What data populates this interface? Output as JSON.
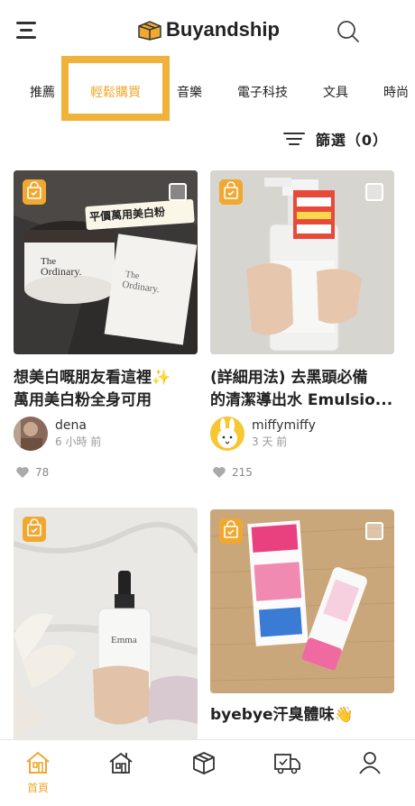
{
  "header": {
    "logo_text": "Buyandship",
    "menu_icon": "hamburger-menu-icon",
    "search_icon": "search-icon"
  },
  "tabs": [
    {
      "label": "推薦",
      "active": false
    },
    {
      "label": "輕鬆購買",
      "active": true
    },
    {
      "label": "音樂",
      "active": false
    },
    {
      "label": "電子科技",
      "active": false
    },
    {
      "label": "文具",
      "active": false
    },
    {
      "label": "時尚",
      "active": false
    }
  ],
  "filter": {
    "label": "篩選（0）"
  },
  "cards": [
    {
      "title_line1": "想美白嘅朋友看這裡✨",
      "title_line2": "萬用美白粉全身可用",
      "image_caption": "平價萬用美白粉",
      "author": "dena",
      "time": "6 小時 前",
      "likes": "78"
    },
    {
      "title_line1": "(詳細用法) 去黑頭必備",
      "title_line2": "的清潔導出水 Emulsio...",
      "author": "miffymiffy",
      "time": "3 天 前",
      "likes": "215"
    },
    {
      "title_line1": "",
      "title_line2": "",
      "author": "",
      "time": "",
      "likes": ""
    },
    {
      "title_line1": "byebye汗臭體味👋",
      "title_line2": "",
      "author": "",
      "time": "",
      "likes": ""
    }
  ],
  "bottom_nav": [
    {
      "label": "首頁",
      "icon": "home-icon",
      "active": true
    },
    {
      "label": "",
      "icon": "store-icon",
      "active": false
    },
    {
      "label": "",
      "icon": "package-icon",
      "active": false
    },
    {
      "label": "",
      "icon": "delivery-truck-icon",
      "active": false
    },
    {
      "label": "",
      "icon": "profile-icon",
      "active": false
    }
  ],
  "colors": {
    "accent": "#F0A830",
    "text": "#222222",
    "muted": "#999999"
  }
}
